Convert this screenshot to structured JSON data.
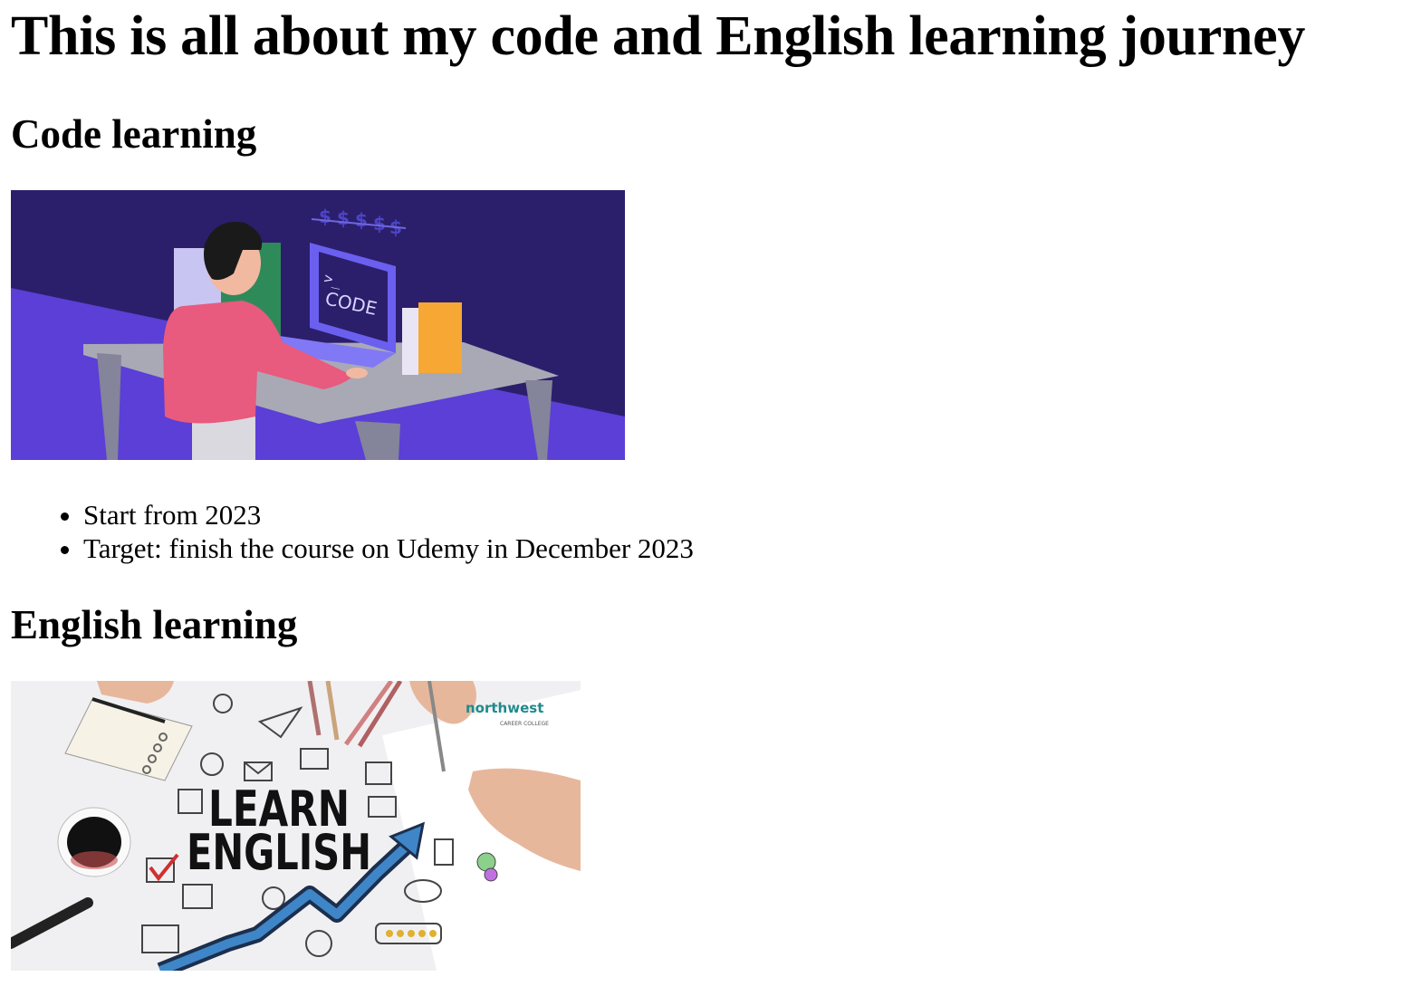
{
  "page": {
    "title": "This is all about my code and English learning journey"
  },
  "code_section": {
    "heading": "Code learning",
    "illustration": {
      "icon": "coding-illustration",
      "screen_text": "CODE",
      "prompt_text": ">_"
    },
    "bullets": [
      "Start from 2023",
      "Target: finish the course on Udemy in December 2023"
    ]
  },
  "english_section": {
    "heading": "English learning",
    "illustration": {
      "icon": "learn-english-illustration",
      "line1": "LEARN",
      "line2": "ENGLISH",
      "brand": "northwest",
      "brand_sub": "CAREER COLLEGE"
    }
  },
  "colors": {
    "code_bg_dark": "#2b1f6b",
    "code_bg_purple": "#5b3fd6",
    "table": "#a9a9b5",
    "shirt": "#e85a7e",
    "laptop": "#6b5ff0",
    "book_orange": "#f6a734",
    "book_green": "#2f8a5a",
    "arrow_blue": "#3f86c8",
    "brand_teal": "#1f8a8c"
  }
}
